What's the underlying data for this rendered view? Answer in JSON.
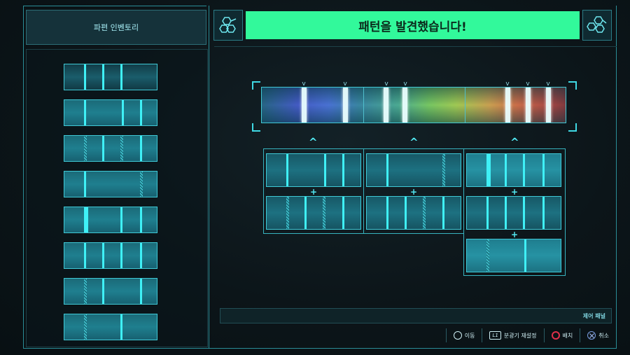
{
  "inventory": {
    "title": "파편 인벤토리"
  },
  "banner": {
    "text": "패턴을 발견했습니다!",
    "color": "#32f99b"
  },
  "icons": {
    "left": "molecule-icon",
    "right": "molecule-icon"
  },
  "footer": {
    "panel_label": "제어 패널",
    "prompts": [
      {
        "button": "left-stick",
        "label": "이동"
      },
      {
        "button": "L1",
        "label": "분광기 재설정"
      },
      {
        "button": "circle",
        "label": "배치"
      },
      {
        "button": "cross",
        "label": "취소"
      }
    ]
  },
  "colors": {
    "accent": "#3ff0f6",
    "frame": "#2a8d97",
    "circle_button": "#e0304a",
    "cross_button": "#7a9ce0"
  }
}
